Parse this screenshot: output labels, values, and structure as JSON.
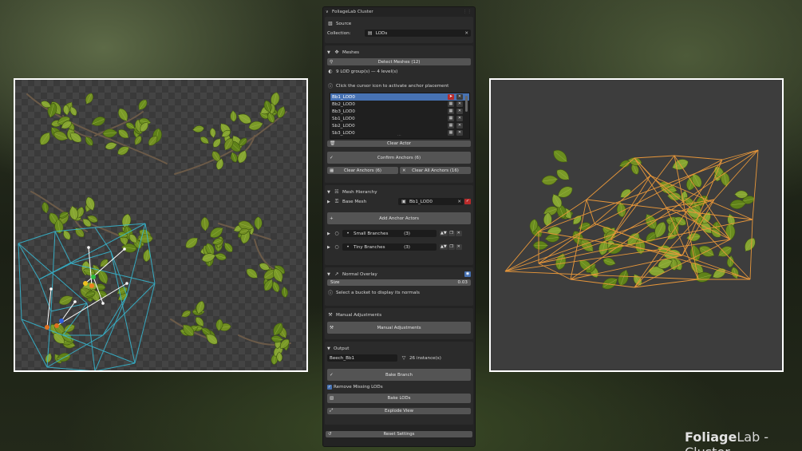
{
  "panel": {
    "title": "FoliageLab Cluster",
    "source": {
      "header": "Source",
      "collection_label": "Collection:",
      "collection_value": "LODs"
    },
    "meshes": {
      "header": "Meshes",
      "detect_button": "Detect Meshes",
      "detect_count": "(12)",
      "lod_info": "9 LOD group(s)  —  4 level(s)",
      "hint": "Click the cursor icon to activate anchor placement",
      "list_items": [
        "Bb1_LOD0",
        "Bb2_LOD0",
        "Bb3_LOD0",
        "Sb1_LOD0",
        "Sb2_LOD0",
        "Sb3_LOD0"
      ],
      "selected_index": 0,
      "clear_actor_button": "Clear Actor",
      "confirm_anchors_button": "Confirm Anchors",
      "confirm_count": "(6)",
      "clear_anchors_button": "Clear Anchors",
      "clear_anchors_count": "(6)",
      "clear_all_anchors_button": "Clear All Anchors",
      "clear_all_count": "(16)"
    },
    "hierarchy": {
      "header": "Mesh Hierarchy",
      "base_mesh_label": "Base Mesh",
      "base_mesh_value": "Bb1_LOD0",
      "add_anchor_button": "Add Anchor Actors",
      "buckets": [
        {
          "label": "Small Branches",
          "count": "(3)"
        },
        {
          "label": "Tiny Branches",
          "count": "(3)"
        }
      ]
    },
    "normal_overlay": {
      "header": "Normal Overlay",
      "size_label": "Size",
      "size_value": "0.03",
      "hint": "Select a bucket to display its normals"
    },
    "manual": {
      "header": "Manual Adjustments",
      "button": "Manual Adjustments"
    },
    "output": {
      "header": "Output",
      "name_value": "Beech_Bb1",
      "instances": "26 instance(s)",
      "bake_branch_button": "Bake Branch",
      "remove_missing_label": "Remove Missing LODs",
      "remove_missing_checked": true,
      "bake_lods_button": "Bake LODs",
      "explode_view_button": "Explode View",
      "reset_button": "Reset Settings"
    }
  },
  "brand": {
    "name_bold": "Foliage",
    "name_rest": "Lab - Cluster"
  },
  "colors": {
    "anchor_wire": "#35b6cf",
    "preview_wire": "#e8973a",
    "leaf": "#6b8e1f",
    "selection": "#4772b3"
  },
  "icons": [
    "collection-icon",
    "search-icon",
    "cursor-icon",
    "trash-icon",
    "check-icon",
    "anchor-icon",
    "cross-icon",
    "hierarchy-icon",
    "mesh-icon",
    "plus-icon",
    "eye-icon",
    "wrench-icon",
    "output-icon",
    "bake-icon",
    "explode-icon",
    "reset-icon"
  ]
}
